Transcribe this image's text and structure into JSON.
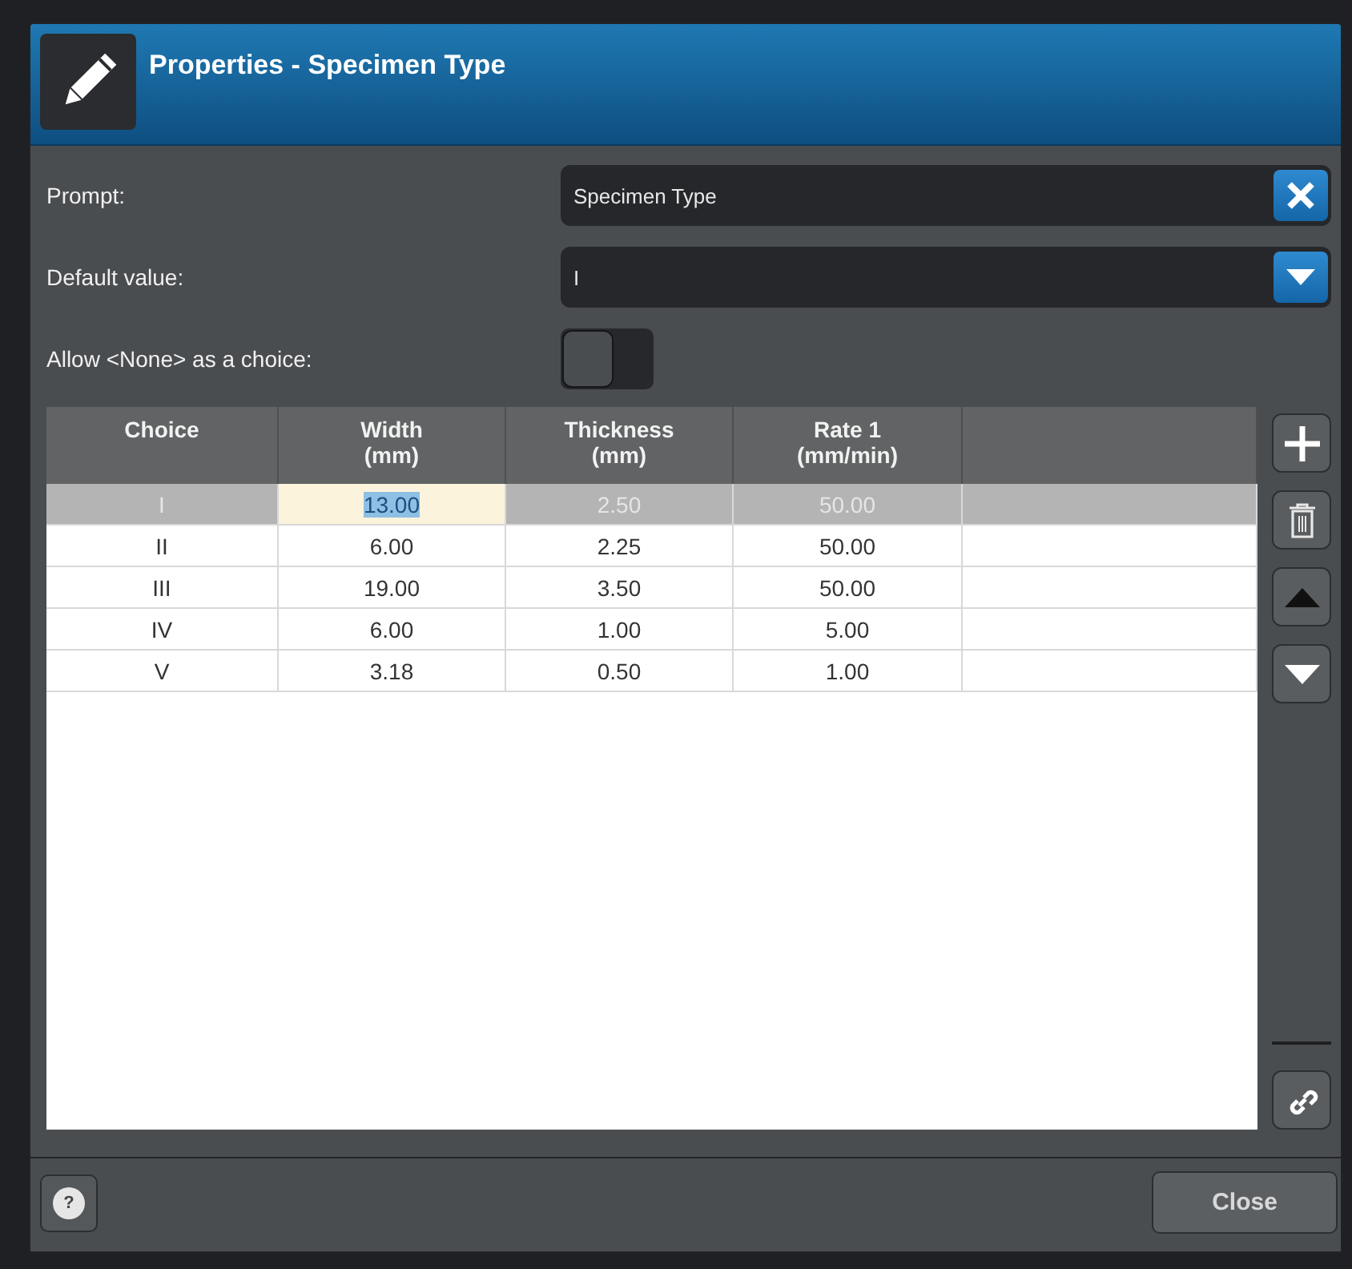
{
  "dialog": {
    "title": "Properties - Specimen Type"
  },
  "form": {
    "prompt": {
      "label": "Prompt:",
      "value": "Specimen Type"
    },
    "default_value": {
      "label": "Default value:",
      "value": "I"
    },
    "allow_none": {
      "label": "Allow <None> as a choice:",
      "on": false
    }
  },
  "table": {
    "columns": [
      "Choice",
      "Width\n(mm)",
      "Thickness\n(mm)",
      "Rate 1\n(mm/min)"
    ],
    "rows": [
      {
        "selected": true,
        "cells": [
          {
            "text": "I",
            "editing": false
          },
          {
            "text": "13.00",
            "editing": true
          },
          {
            "text": "2.50",
            "editing": false
          },
          {
            "text": "50.00",
            "editing": false
          }
        ]
      },
      {
        "selected": false,
        "cells": [
          {
            "text": "II",
            "editing": false
          },
          {
            "text": "6.00",
            "editing": false
          },
          {
            "text": "2.25",
            "editing": false
          },
          {
            "text": "50.00",
            "editing": false
          }
        ]
      },
      {
        "selected": false,
        "cells": [
          {
            "text": "III",
            "editing": false
          },
          {
            "text": "19.00",
            "editing": false
          },
          {
            "text": "3.50",
            "editing": false
          },
          {
            "text": "50.00",
            "editing": false
          }
        ]
      },
      {
        "selected": false,
        "cells": [
          {
            "text": "IV",
            "editing": false
          },
          {
            "text": "6.00",
            "editing": false
          },
          {
            "text": "1.00",
            "editing": false
          },
          {
            "text": "5.00",
            "editing": false
          }
        ]
      },
      {
        "selected": false,
        "cells": [
          {
            "text": "V",
            "editing": false
          },
          {
            "text": "3.18",
            "editing": false
          },
          {
            "text": "0.50",
            "editing": false
          },
          {
            "text": "1.00",
            "editing": false
          }
        ]
      }
    ]
  },
  "side_tools": [
    {
      "kind": "add"
    },
    {
      "kind": "delete"
    },
    {
      "kind": "up"
    },
    {
      "kind": "down"
    },
    {
      "kind": "link"
    }
  ],
  "footer": {
    "help": "?",
    "close": "Close"
  }
}
